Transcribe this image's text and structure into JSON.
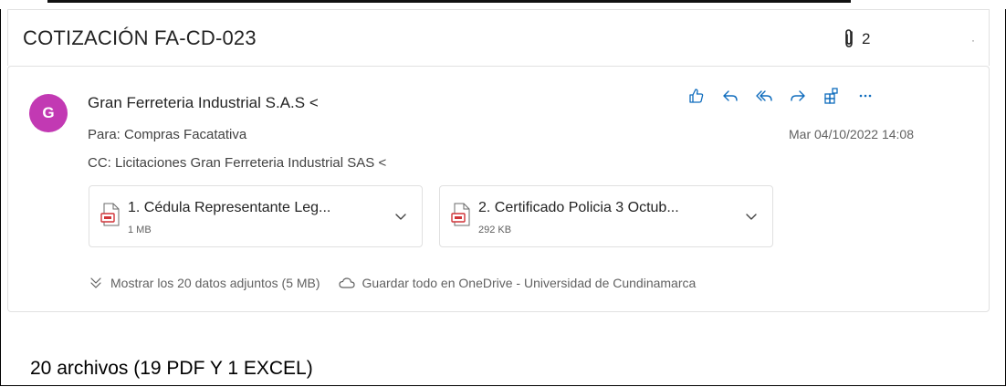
{
  "email": {
    "subject": "COTIZACIÓN FA-CD-023",
    "attachment_count": "2",
    "sender_initial": "G",
    "sender": "Gran Ferreteria Industrial S.A.S <",
    "to_line": "Para:  Compras Facatativa",
    "cc_line": "CC:  Licitaciones Gran Ferreteria Industrial SAS <",
    "date": "Mar 04/10/2022 14:08",
    "actions": [
      {
        "name": "like",
        "icon": "thumbs-up-icon"
      },
      {
        "name": "reply",
        "icon": "reply-icon"
      },
      {
        "name": "reply-all",
        "icon": "reply-all-icon"
      },
      {
        "name": "forward",
        "icon": "forward-icon"
      },
      {
        "name": "apps",
        "icon": "apps-icon"
      },
      {
        "name": "more",
        "icon": "more-icon"
      }
    ],
    "attachments": [
      {
        "name": "1. Cédula Representante Leg...",
        "size": "1 MB"
      },
      {
        "name": "2. Certificado Policia 3 Octub...",
        "size": "292 KB"
      }
    ],
    "show_all": "Mostrar los 20 datos adjuntos (5 MB)",
    "save_onedrive": "Guardar todo en OneDrive - Universidad de Cundinamarca"
  },
  "note": "20 archivos (19 PDF Y 1 EXCEL)",
  "colors": {
    "avatar": "#c239b3",
    "action_blue": "#0f6cbd",
    "pdf_red": "#d13438"
  }
}
